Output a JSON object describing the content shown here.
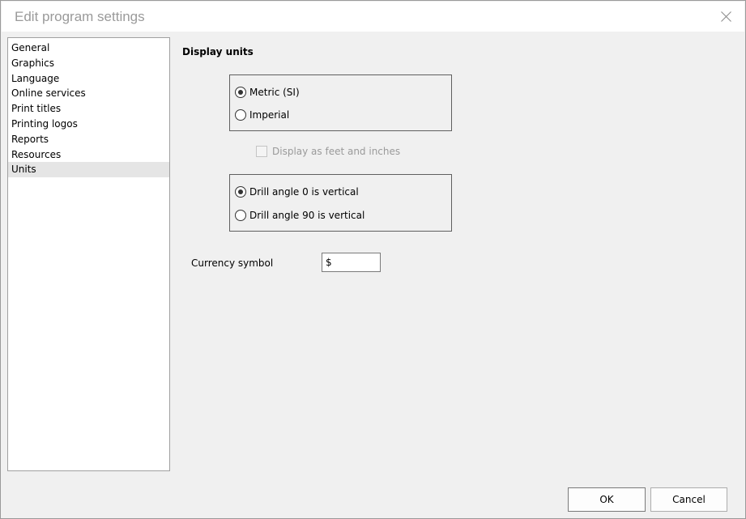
{
  "window": {
    "title": "Edit program settings"
  },
  "nav": {
    "items": [
      {
        "label": "General"
      },
      {
        "label": "Graphics"
      },
      {
        "label": "Language"
      },
      {
        "label": "Online services"
      },
      {
        "label": "Print titles"
      },
      {
        "label": "Printing logos"
      },
      {
        "label": "Reports"
      },
      {
        "label": "Resources"
      },
      {
        "label": "Units"
      }
    ],
    "selected": "Units"
  },
  "section": {
    "heading": "Display units"
  },
  "unit_system": {
    "options": [
      {
        "label": "Metric (SI)",
        "selected": true
      },
      {
        "label": "Imperial",
        "selected": false
      }
    ]
  },
  "feet_inches": {
    "label": "Display as feet and inches",
    "checked": false,
    "enabled": false
  },
  "drill_angle": {
    "options": [
      {
        "label": "Drill angle 0 is vertical",
        "selected": true
      },
      {
        "label": "Drill angle 90 is vertical",
        "selected": false
      }
    ]
  },
  "currency": {
    "label": "Currency symbol",
    "value": "$"
  },
  "buttons": {
    "ok": "OK",
    "cancel": "Cancel"
  },
  "colors": {
    "dialog_background": "#f0f0f0",
    "title_text": "#9a9a9a",
    "selected_item": "#e5e5e5",
    "disabled_text": "#9a9a9a"
  },
  "icons": {
    "close": "close-icon"
  }
}
